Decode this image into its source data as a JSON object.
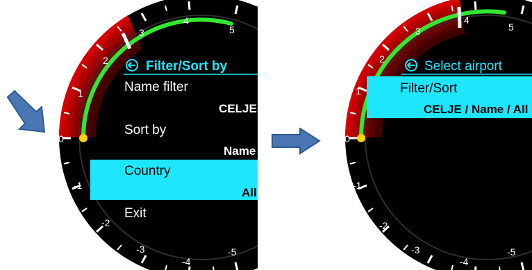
{
  "left_screen": {
    "title": "Filter/Sort by",
    "items": [
      {
        "label": "Name filter",
        "value": "CELJE",
        "selected": false
      },
      {
        "label": "Sort by",
        "value": "Name",
        "selected": false
      },
      {
        "label": "Country",
        "value": "All",
        "selected": true
      },
      {
        "label": "Exit",
        "value": "",
        "selected": false
      }
    ]
  },
  "right_screen": {
    "title": "Select airport",
    "items": [
      {
        "label": "Filter/Sort",
        "value": "CELJE / Name / All",
        "selected": true
      }
    ]
  },
  "gauge": {
    "scale_labels": [
      "5",
      "4",
      "3",
      "2",
      "1",
      "0",
      "-1",
      "-2",
      "-3",
      "-4",
      "-5"
    ]
  },
  "colors": {
    "accent_cyan": "#1ee6ff",
    "arc_green": "#33e633",
    "zone_red": "#e00000",
    "indicator_yellow": "#ffd400",
    "arrow_blue": "#4a77b4"
  },
  "icons": [
    "back-circle-icon",
    "arrow-right-icon",
    "arrow-down-right-icon"
  ]
}
